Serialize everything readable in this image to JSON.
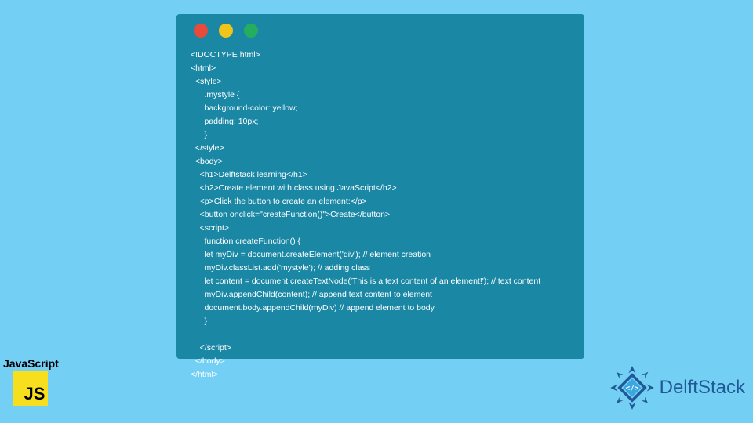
{
  "window_controls": {
    "red": "#e84b3c",
    "yellow": "#f0c419",
    "green": "#25ae5f"
  },
  "code_lines": [
    "<!DOCTYPE html>",
    "<html>",
    "  <style>",
    "      .mystyle {",
    "      background-color: yellow;",
    "      padding: 10px;",
    "      }",
    "  </style>",
    "  <body>",
    "    <h1>Delftstack learning</h1>",
    "    <h2>Create element with class using JavaScript</h2>",
    "    <p>Click the button to create an element:</p>",
    "    <button onclick=\"createFunction()\">Create</button>",
    "    <script>",
    "      function createFunction() {",
    "      let myDiv = document.createElement('div'); // element creation",
    "      myDiv.classList.add('mystyle'); // adding class",
    "      let content = document.createTextNode('This is a text content of an element!'); // text content",
    "      myDiv.appendChild(content); // append text content to element",
    "      document.body.appendChild(myDiv) // append element to body",
    "      }",
    "",
    "    </script>",
    "  </body>",
    "</html>"
  ],
  "js_badge": {
    "label": "JavaScript",
    "logo_text": "JS"
  },
  "brand": {
    "name": "DelftStack"
  }
}
